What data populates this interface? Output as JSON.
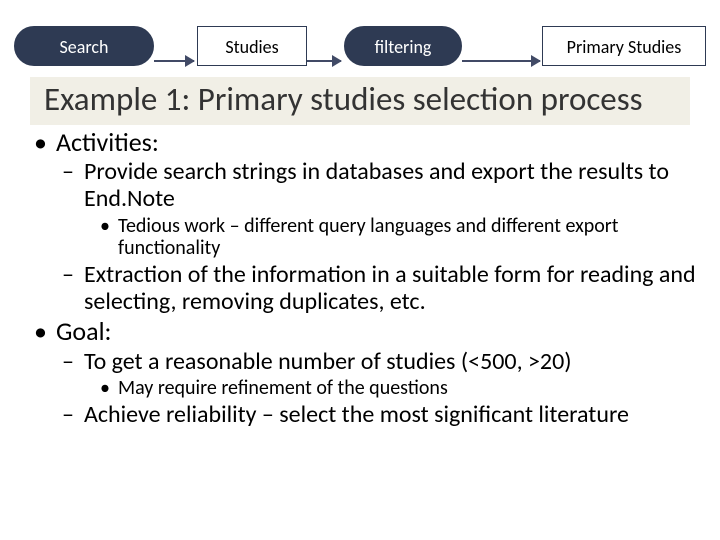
{
  "flow": {
    "search": "Search",
    "studies": "Studies",
    "filtering": "filtering",
    "primary": "Primary Studies"
  },
  "title": "Example 1: Primary studies selection process",
  "body": {
    "activities_label": "Activities:",
    "act1": "Provide search strings in databases and export the results to End.Note",
    "act1_sub": "Tedious work – different query languages and different export functionality",
    "act2": "Extraction of the information in a suitable form for reading and selecting, removing duplicates, etc.",
    "goal_label": "Goal:",
    "goal1": "To get a reasonable number of studies (<500, >20)",
    "goal1_sub": "May require refinement of the questions",
    "goal2": "Achieve reliability – select the most significant literature"
  }
}
